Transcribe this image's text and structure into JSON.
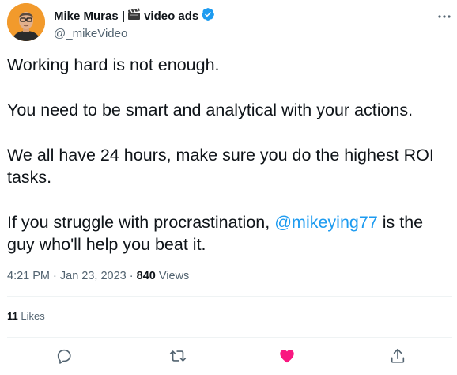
{
  "author": {
    "name": "Mike Muras | ",
    "name_suffix": " video ads",
    "handle": "@_mikeVideo",
    "verified": true,
    "avatar_bg": "#f29a2c"
  },
  "icons": {
    "more": "more-horizontal-icon",
    "reply": "reply-icon",
    "retweet": "retweet-icon",
    "like": "heart-filled-icon",
    "share": "share-icon",
    "clapper": "clapper-board-icon",
    "verified": "verified-badge-icon"
  },
  "tweet": {
    "p1": "Working hard is not enough.",
    "p2": "You need to be smart and analytical with your actions.",
    "p3": "We all have 24 hours, make sure you do the highest ROI tasks.",
    "p4_before": "If you struggle with procrastination, ",
    "p4_mention": " @mikeying77",
    "p4_after": " is the guy who'll help you beat it."
  },
  "meta": {
    "time": "4:21 PM",
    "separator1": " · ",
    "date": "Jan 23, 2023",
    "separator2": " · ",
    "views_count": "840",
    "views_label": " Views"
  },
  "engagement": {
    "likes_count": "11",
    "likes_label": " Likes"
  },
  "colors": {
    "accent": "#1d9bf0",
    "like": "#f91880",
    "secondary_text": "#536471",
    "divider": "#eff3f4"
  }
}
